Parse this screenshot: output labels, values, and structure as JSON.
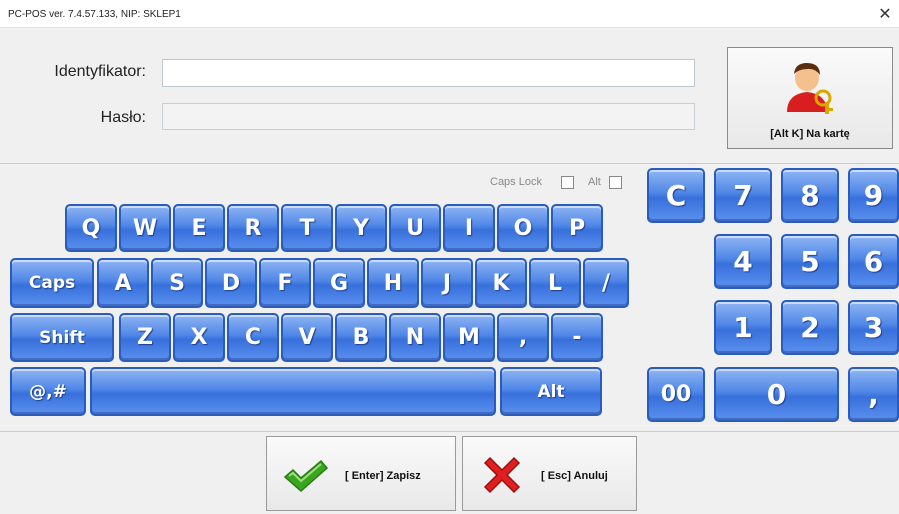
{
  "window": {
    "title": "PC-POS ver. 7.4.57.133, NIP: SKLEP1",
    "close_glyph": "✕"
  },
  "login": {
    "identifier_label": "Identyfikator:",
    "identifier_value": "",
    "password_label": "Hasło:",
    "password_value": ""
  },
  "card_button": {
    "label": "[Alt K] Na kartę",
    "icon": "user-key-icon"
  },
  "options": {
    "caps_lock_label": "Caps Lock",
    "alt_label": "Alt",
    "caps_lock_checked": false,
    "alt_checked": false
  },
  "keyboard": {
    "row1": [
      "Q",
      "W",
      "E",
      "R",
      "T",
      "Y",
      "U",
      "I",
      "O",
      "P"
    ],
    "row2": [
      "Caps",
      "A",
      "S",
      "D",
      "F",
      "G",
      "H",
      "J",
      "K",
      "L",
      "/"
    ],
    "row3": [
      "Shift",
      "Z",
      "X",
      "C",
      "V",
      "B",
      "N",
      "M",
      ",",
      "-"
    ],
    "row4": [
      "@,#",
      "",
      "Alt"
    ]
  },
  "numpad": {
    "clear": "C",
    "digits": [
      "7",
      "8",
      "9",
      "4",
      "5",
      "6",
      "1",
      "2",
      "3"
    ],
    "double_zero": "00",
    "zero": "0",
    "comma": ","
  },
  "actions": {
    "save_label": "[ Enter] Zapisz",
    "cancel_label": "[ Esc] Anuluj",
    "save_icon": "checkmark-icon",
    "cancel_icon": "cross-icon"
  },
  "colors": {
    "key_blue": "#3870dc",
    "check_green": "#3aa51f",
    "cancel_red": "#e02020"
  }
}
